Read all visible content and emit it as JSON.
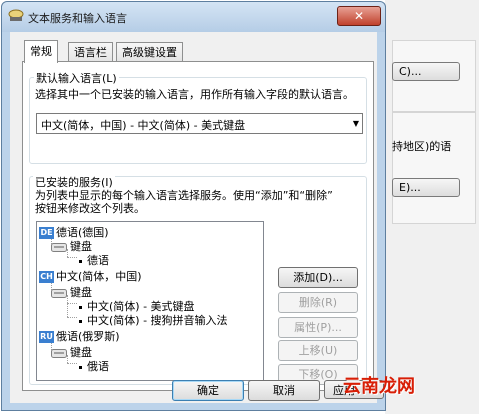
{
  "background_window": {
    "button1_label": "C)...",
    "side_text": "持地区)的语",
    "button2_label": "E)..."
  },
  "dialog": {
    "title": "文本服务和输入语言",
    "close_label": "✕",
    "tabs": [
      {
        "label": "常规",
        "active": true
      },
      {
        "label": "语言栏",
        "active": false
      },
      {
        "label": "高级键设置",
        "active": false
      }
    ],
    "default_language": {
      "group_label": "默认输入语言(L)",
      "description": "选择其中一个已安装的输入语言，用作所有输入字段的默认语言。",
      "selected": "中文(简体，中国) - 中文(简体) - 美式键盘"
    },
    "installed_services": {
      "group_label": "已安装的服务(I)",
      "description_line1": "为列表中显示的每个输入语言选择服务。使用“添加”和“删除”",
      "description_line2": "按钮来修改这个列表。",
      "tree": [
        {
          "badge": "DE",
          "name": "德语(德国)",
          "category": "键盘",
          "items": [
            "德语"
          ]
        },
        {
          "badge": "CH",
          "name": "中文(简体，中国)",
          "category": "键盘",
          "items": [
            "中文(简体) - 美式键盘",
            "中文(简体) - 搜狗拼音输入法"
          ]
        },
        {
          "badge": "RU",
          "name": "俄语(俄罗斯)",
          "category": "键盘",
          "items": [
            "俄语"
          ]
        }
      ],
      "buttons": {
        "add": "添加(D)...",
        "remove": "删除(R)",
        "properties": "属性(P)...",
        "move_up": "上移(U)",
        "move_down": "下移(O)"
      }
    },
    "footer": {
      "ok": "确定",
      "cancel": "取消",
      "apply": "应用"
    }
  },
  "watermark": "云南龙网",
  "colors": {
    "badge": "#3a7fd0",
    "watermark": "#d81e06",
    "title_bar": "#b5cde6"
  }
}
